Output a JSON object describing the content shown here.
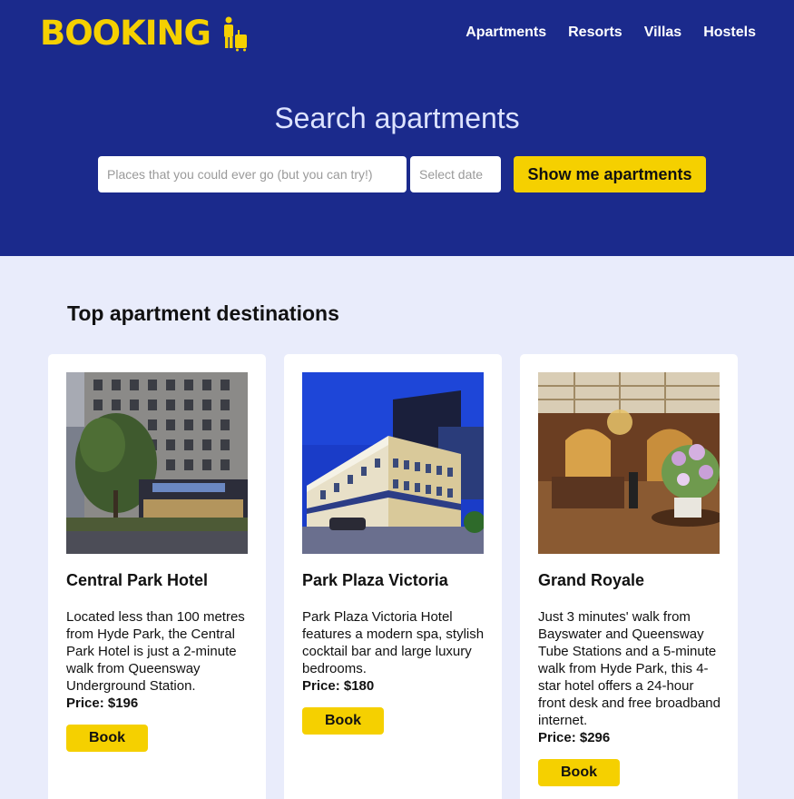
{
  "brand": {
    "name": "BOOKING",
    "icon": "traveler-with-luggage-icon",
    "color": "#f5d000"
  },
  "nav": {
    "items": [
      "Apartments",
      "Resorts",
      "Villas",
      "Hostels"
    ]
  },
  "hero": {
    "title": "Search apartments",
    "search_placeholder": "Places that you could ever go (but you can try!)",
    "date_placeholder": "Select date",
    "button_label": "Show me apartments",
    "background": "#1b2a8c"
  },
  "section": {
    "title": "Top apartment destinations"
  },
  "cards": [
    {
      "name": "Central Park Hotel",
      "description": "Located less than 100 metres from Hyde Park, the Central Park Hotel is just a 2-minute walk from Queensway Underground Station.",
      "price": "Price: $196",
      "book_label": "Book"
    },
    {
      "name": "Park Plaza Victoria",
      "description": "Park Plaza Victoria Hotel features a modern spa, stylish cocktail bar and large luxury bedrooms.",
      "price": "Price: $180",
      "book_label": "Book"
    },
    {
      "name": "Grand Royale",
      "description": "Just 3 minutes' walk from Bayswater and Queensway Tube Stations and a 5-minute walk from Hyde Park, this 4-star hotel offers a 24-hour front desk and free broadband internet.",
      "price": "Price: $296",
      "book_label": "Book"
    }
  ]
}
